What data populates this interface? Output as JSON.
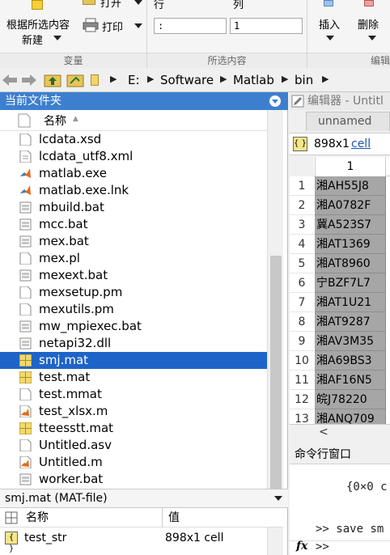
{
  "toolstrip": {
    "variable_section": {
      "new_from_selection_label_line1": "根据所选内容",
      "new_from_selection_label_line2": "新建",
      "open_label": "打开",
      "print_label": "打印",
      "title": "变量"
    },
    "selection_section": {
      "row_label": "行",
      "col_label": "列",
      "row_value": ":",
      "col_value": "1",
      "title": "所选内容"
    },
    "edit_section": {
      "insert_label": "插入",
      "delete_label": "删除",
      "title": "编辑"
    }
  },
  "addressbar": {
    "path": [
      "E:",
      "Software",
      "Matlab",
      "bin"
    ]
  },
  "current_folder": {
    "title": "当前文件夹",
    "column_name": "名称",
    "files": [
      {
        "name": "lcdata.xsd",
        "icon": "document-icon"
      },
      {
        "name": "lcdata_utf8.xml",
        "icon": "xml-file-icon"
      },
      {
        "name": "matlab.exe",
        "icon": "matlab-logo-icon"
      },
      {
        "name": "matlab.exe.lnk",
        "icon": "matlab-logo-icon"
      },
      {
        "name": "mbuild.bat",
        "icon": "batch-file-icon"
      },
      {
        "name": "mcc.bat",
        "icon": "batch-file-icon"
      },
      {
        "name": "mex.bat",
        "icon": "batch-file-icon"
      },
      {
        "name": "mex.pl",
        "icon": "document-icon"
      },
      {
        "name": "mexext.bat",
        "icon": "batch-file-icon"
      },
      {
        "name": "mexsetup.pm",
        "icon": "document-icon"
      },
      {
        "name": "mexutils.pm",
        "icon": "document-icon"
      },
      {
        "name": "mw_mpiexec.bat",
        "icon": "batch-file-icon"
      },
      {
        "name": "netapi32.dll",
        "icon": "batch-file-icon"
      },
      {
        "name": "smj.mat",
        "icon": "mat-file-icon",
        "selected": true
      },
      {
        "name": "test.mat",
        "icon": "mat-file-icon"
      },
      {
        "name": "test.mmat",
        "icon": "document-icon"
      },
      {
        "name": "test_xlsx.m",
        "icon": "m-file-icon"
      },
      {
        "name": "tteesstt.mat",
        "icon": "mat-file-icon"
      },
      {
        "name": "Untitled.asv",
        "icon": "document-icon"
      },
      {
        "name": "Untitled.m",
        "icon": "m-file-icon"
      },
      {
        "name": "worker.bat",
        "icon": "batch-file-icon"
      }
    ],
    "details_text": "smj.mat  (MAT-file)",
    "workspace": {
      "col_name": "名称",
      "col_value": "值",
      "rows": [
        {
          "name": "test_str",
          "value": "898x1 cell"
        }
      ]
    }
  },
  "variable_editor": {
    "title": "编辑器 - Untitl",
    "tab": "unnamed",
    "size_text": "898x1",
    "class_text": "cell",
    "column_header": "1",
    "rows": [
      {
        "index": "1",
        "value": "湘AH55J8"
      },
      {
        "index": "2",
        "value": "湘A0782F"
      },
      {
        "index": "3",
        "value": "冀A523S7"
      },
      {
        "index": "4",
        "value": "湘AT1369"
      },
      {
        "index": "5",
        "value": "湘AT8960"
      },
      {
        "index": "6",
        "value": "宁BZF7L7"
      },
      {
        "index": "7",
        "value": "湘AT1U21"
      },
      {
        "index": "8",
        "value": "湘AT9287"
      },
      {
        "index": "9",
        "value": "湘AV3M35"
      },
      {
        "index": "10",
        "value": "湘A69BS3"
      },
      {
        "index": "11",
        "value": "湘AF16N5"
      },
      {
        "index": "12",
        "value": "皖J78220"
      },
      {
        "index": "13",
        "value": "湘ANQ709"
      }
    ]
  },
  "command_window": {
    "title": "命令行窗口",
    "output_line": "{0×0 c",
    "history_line": ">> save sm",
    "prompt": ">>",
    "fx_label": "fx"
  },
  "colors": {
    "header_blue": "#3d7fcf",
    "selection_blue": "#1e64c8",
    "cell_gray": "#a6a6a6",
    "link_blue": "#1a4fb8"
  }
}
